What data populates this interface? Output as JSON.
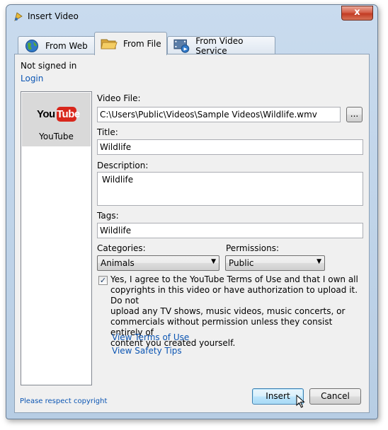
{
  "window": {
    "title": "Insert Video",
    "close_glyph": "x"
  },
  "tabs": [
    {
      "label": "From Web",
      "icon": "globe-icon",
      "active": false
    },
    {
      "label": "From File",
      "icon": "folder-icon",
      "active": true
    },
    {
      "label": "From Video Service",
      "icon": "film-globe-icon",
      "active": false
    }
  ],
  "account": {
    "status": "Not signed in",
    "login_link": "Login"
  },
  "services": [
    {
      "logo_you": "You",
      "logo_tube": "Tube",
      "name": "YouTube",
      "selected": true
    }
  ],
  "form": {
    "video_file_label": "Video File:",
    "video_file_value": "C:\\Users\\Public\\Videos\\Sample Videos\\Wildlife.wmv",
    "browse_label": "...",
    "title_label": "Title:",
    "title_value": "Wildlife",
    "description_label": "Description:",
    "description_value": "Wildlife",
    "tags_label": "Tags:",
    "tags_value": "Wildlife",
    "categories_label": "Categories:",
    "categories_value": "Animals",
    "permissions_label": "Permissions:",
    "permissions_value": "Public",
    "agree_checked": true,
    "agree_lines": [
      "Yes, I agree to the YouTube Terms of Use and that I own all",
      "copyrights in this video or have authorization to upload it. Do not",
      "upload any TV shows, music videos, music concerts, or",
      "commercials without permission unless they consist entirely of",
      "content you created yourself."
    ],
    "terms_link": "View Terms of Use",
    "safety_link": "View Safety Tips"
  },
  "footer": {
    "copyright_link": "Please respect copyright",
    "insert_label": "Insert",
    "cancel_label": "Cancel"
  },
  "colors": {
    "link": "#0b55b3",
    "youtube_red": "#d8271c",
    "frame": "#b7cde4"
  }
}
